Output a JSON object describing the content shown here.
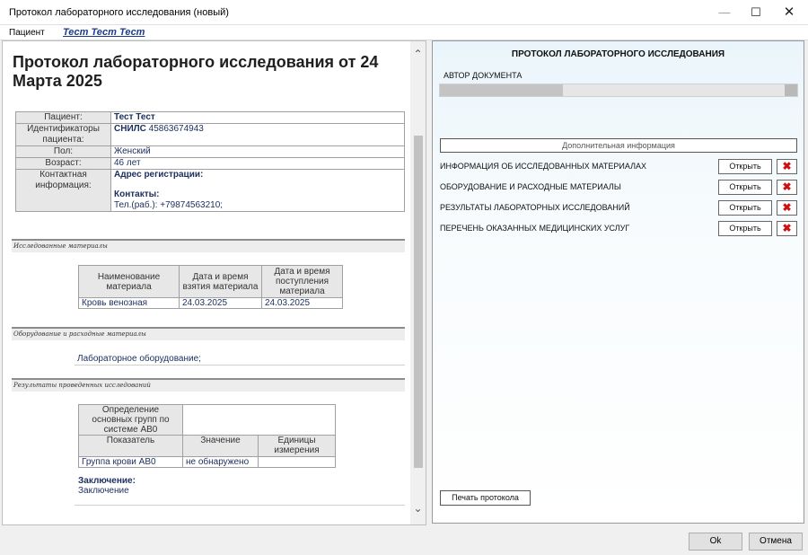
{
  "window": {
    "title": "Протокол лабораторного исследования (новый)",
    "minimize": "—",
    "maximize": "☐",
    "close": "✕"
  },
  "patient_bar": {
    "label": "Пациент",
    "name": "Тест Тест Тест"
  },
  "document": {
    "heading": "Протокол лабораторного исследования от 24 Марта 2025",
    "patient_info": {
      "patient_label": "Пациент:",
      "patient_value": "Тест Тест",
      "ids_label": "Идентификаторы пациента:",
      "ids_key": "СНИЛС",
      "ids_value": "45863674943",
      "sex_label": "Пол:",
      "sex_value": "Женский",
      "age_label": "Возраст:",
      "age_value": "46 лет",
      "contact_label": "Контактная информация:",
      "reg_address_label": "Адрес регистрации:",
      "contacts_label": "Контакты:",
      "phone": "Тел.(раб.): +79874563210;"
    },
    "materials_section": "Исследованные материалы",
    "materials_headers": [
      "Наименование материала",
      "Дата и время взятия материала",
      "Дата и время поступления материала"
    ],
    "materials_rows": [
      [
        "Кровь венозная",
        "24.03.2025",
        "24.03.2025"
      ]
    ],
    "equipment_section": "Оборудование и расходные материалы",
    "equipment_value": "Лабораторное оборудование;",
    "results_section": "Результаты проведенных исследований",
    "results_group": "Определение основных групп по системе AB0",
    "results_headers": [
      "Показатель",
      "Значение",
      "Единицы измерения"
    ],
    "results_rows": [
      [
        "Группа крови AB0",
        "не обнаружено",
        ""
      ]
    ],
    "conclusion_label": "Заключение:",
    "conclusion_value": "Заключение"
  },
  "right_panel": {
    "title": "ПРОТОКОЛ ЛАБОРАТОРНОГО ИССЛЕДОВАНИЯ",
    "author_label": "АВТОР ДОКУМЕНТА",
    "extra_info_button": "Дополнительная информация",
    "rows": [
      {
        "label": "ИНФОРМАЦИЯ ОБ ИССЛЕДОВАННЫХ МАТЕРИАЛАХ",
        "open": "Открыть"
      },
      {
        "label": "ОБОРУДОВАНИЕ И РАСХОДНЫЕ МАТЕРИАЛЫ",
        "open": "Открыть"
      },
      {
        "label": "РЕЗУЛЬТАТЫ ЛАБОРАТОРНЫХ ИССЛЕДОВАНИЙ",
        "open": "Открыть"
      },
      {
        "label": "ПЕРЕЧЕНЬ ОКАЗАННЫХ МЕДИЦИНСКИХ УСЛУГ",
        "open": "Открыть"
      }
    ],
    "delete_icon": "delete-icon",
    "print_button": "Печать протокола"
  },
  "footer": {
    "ok_label": "Ok",
    "cancel_label": "Отмена"
  },
  "colors": {
    "link": "#1a3c8c",
    "value_text": "#1b2e5e",
    "delete_red": "#d01010"
  }
}
